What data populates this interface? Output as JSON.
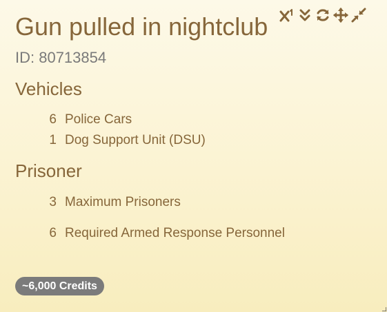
{
  "mission": {
    "title": "Gun pulled in nightclub",
    "id_label": "ID: 80713854"
  },
  "toolbar": {
    "icons": [
      {
        "name": "superscript-icon"
      },
      {
        "name": "chevron-double-down-icon"
      },
      {
        "name": "refresh-icon"
      },
      {
        "name": "move-icon"
      },
      {
        "name": "compress-icon"
      }
    ]
  },
  "vehicles": {
    "heading": "Vehicles",
    "items": [
      {
        "count": "6",
        "label": "Police Cars"
      },
      {
        "count": "1",
        "label": "Dog Support Unit (DSU)"
      }
    ]
  },
  "prisoner": {
    "heading": "Prisoner",
    "items": [
      {
        "count": "3",
        "label": "Maximum Prisoners"
      },
      {
        "count": "6",
        "label": "Required Armed Response Personnel"
      }
    ]
  },
  "credits": {
    "label": "~6,000 Credits"
  },
  "colors": {
    "text_primary": "#86663a",
    "text_muted": "#7a7a7a",
    "badge_bg": "#7b7b7b",
    "background_top": "#fdf9e8",
    "background_bottom": "#f8edbe"
  }
}
